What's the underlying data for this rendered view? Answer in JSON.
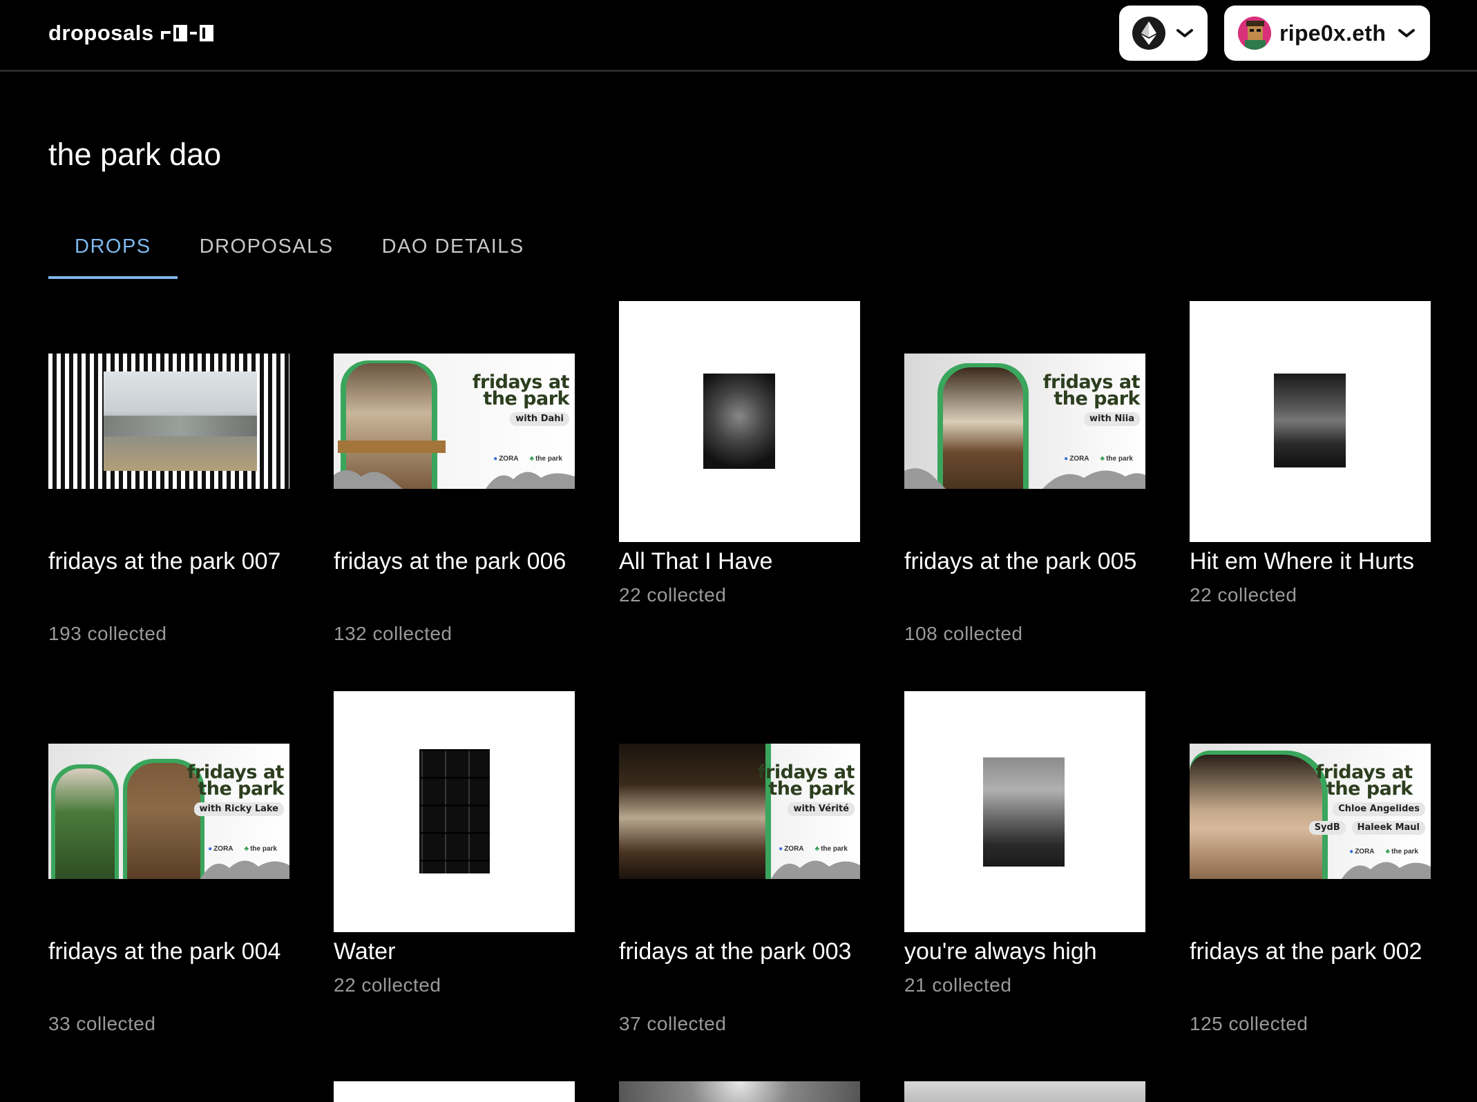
{
  "app": {
    "logo_text": "droposals",
    "network_icon": "ethereum-icon",
    "account_name": "ripe0x.eth"
  },
  "page": {
    "title": "the park dao"
  },
  "tabs": [
    {
      "label": "DROPS",
      "active": true
    },
    {
      "label": "DROPOSALS",
      "active": false
    },
    {
      "label": "DAO DETAILS",
      "active": false
    }
  ],
  "drops": [
    {
      "title": "fridays at the park 007",
      "collected": "193 collected"
    },
    {
      "title": "fridays at the park 006",
      "collected": "132 collected",
      "promo": {
        "heading": "fridays at the park",
        "with": "with Dahi",
        "logos": [
          "ZORA",
          "the park"
        ]
      }
    },
    {
      "title": "All That I Have",
      "collected": "22 collected"
    },
    {
      "title": "fridays at the park 005",
      "collected": "108 collected",
      "promo": {
        "heading": "fridays at the park",
        "with": "with Niia",
        "logos": [
          "ZORA",
          "the park"
        ]
      }
    },
    {
      "title": "Hit em Where it Hurts",
      "collected": "22 collected"
    },
    {
      "title": "fridays at the park 004",
      "collected": "33 collected",
      "promo": {
        "heading": "fridays at the park",
        "with": "with Ricky Lake",
        "logos": [
          "ZORA",
          "the park"
        ]
      }
    },
    {
      "title": "Water",
      "collected": "22 collected"
    },
    {
      "title": "fridays at the park 003",
      "collected": "37 collected",
      "promo": {
        "heading": "fridays at the park",
        "with": "with Vérité",
        "logos": [
          "ZORA",
          "the park"
        ]
      }
    },
    {
      "title": "you're always high",
      "collected": "21 collected"
    },
    {
      "title": "fridays at the park 002",
      "collected": "125 collected",
      "promo": {
        "heading": "fridays at the park",
        "with": "Chloe Angelides",
        "with2a": "SydB",
        "with2b": "Haleek Maul",
        "logos": [
          "ZORA",
          "the park"
        ]
      }
    }
  ]
}
